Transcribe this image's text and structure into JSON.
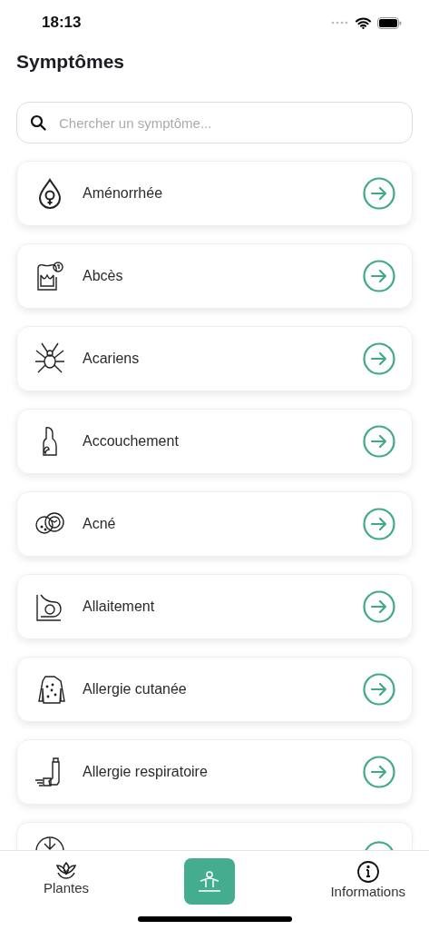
{
  "status_bar": {
    "time": "18:13"
  },
  "title": "Symptômes",
  "search": {
    "placeholder": "Chercher un symptôme..."
  },
  "symptoms": [
    {
      "kind": "full",
      "label": "Aménorrhée"
    },
    {
      "kind": "full",
      "label": "Abcès"
    },
    {
      "kind": "full",
      "label": "Acariens"
    },
    {
      "kind": "full",
      "label": "Accouchement"
    },
    {
      "kind": "full",
      "label": "Acné"
    },
    {
      "kind": "full",
      "label": "Allaitement"
    },
    {
      "kind": "full",
      "label": "Allergie cutanée"
    },
    {
      "kind": "full",
      "label": "Allergie respiratoire"
    },
    {
      "kind": "partial"
    }
  ],
  "tabs": [
    {
      "label": "Plantes",
      "selected": false
    },
    {
      "selected": true
    },
    {
      "label": "Informations",
      "selected": false
    }
  ]
}
